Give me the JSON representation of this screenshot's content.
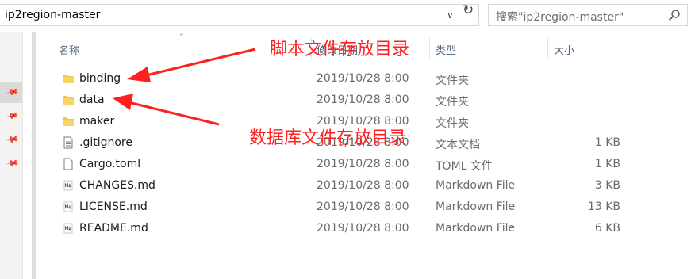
{
  "address": {
    "path": "ip2region-master"
  },
  "search": {
    "placeholder": "搜索\"ip2region-master\""
  },
  "columns": {
    "name": "名称",
    "date": "修改日期",
    "type": "类型",
    "size": "大小"
  },
  "files": [
    {
      "name": "binding",
      "date": "2019/10/28 8:00",
      "type": "文件夹",
      "size": "",
      "icon": "folder-icon"
    },
    {
      "name": "data",
      "date": "2019/10/28 8:00",
      "type": "文件夹",
      "size": "",
      "icon": "folder-icon"
    },
    {
      "name": "maker",
      "date": "2019/10/28 8:00",
      "type": "文件夹",
      "size": "",
      "icon": "folder-icon"
    },
    {
      "name": ".gitignore",
      "date": "2019/10/28 8:00",
      "type": "文本文档",
      "size": "1 KB",
      "icon": "text-file-icon"
    },
    {
      "name": "Cargo.toml",
      "date": "2019/10/28 8:00",
      "type": "TOML 文件",
      "size": "1 KB",
      "icon": "blank-file-icon"
    },
    {
      "name": "CHANGES.md",
      "date": "2019/10/28 8:00",
      "type": "Markdown File",
      "size": "3 KB",
      "icon": "markdown-file-icon"
    },
    {
      "name": "LICENSE.md",
      "date": "2019/10/28 8:00",
      "type": "Markdown File",
      "size": "13 KB",
      "icon": "markdown-file-icon"
    },
    {
      "name": "README.md",
      "date": "2019/10/28 8:00",
      "type": "Markdown File",
      "size": "6 KB",
      "icon": "markdown-file-icon"
    }
  ],
  "annotations": {
    "script_dir": "脚本文件存放目录",
    "db_dir": "数据库文件存放目录"
  },
  "colors": {
    "annotation": "#ff2020",
    "folder": "#f0c64c",
    "header_text": "#4c607a"
  }
}
